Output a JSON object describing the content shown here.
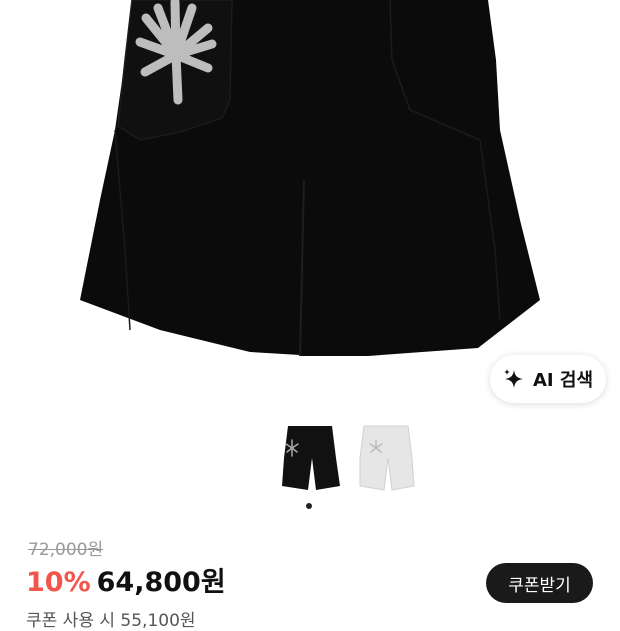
{
  "product": {
    "main_image": "black-shorts-photo",
    "ai_search_label": "AI 검색",
    "ai_search_icon": "sparkle-icon",
    "thumbnails": [
      {
        "name": "black-shorts-thumbnail",
        "color": "#111111"
      },
      {
        "name": "white-shorts-thumbnail",
        "color": "#e6e6e6"
      }
    ],
    "carousel_dot": "page-indicator-dot"
  },
  "pricing": {
    "original_price": "72,000원",
    "discount": "10%",
    "sale_price": "64,800원",
    "coupon_button": "쿠폰받기",
    "coupon_price_text": "쿠폰 사용 시 55,100원"
  },
  "colors": {
    "discount": "#f2554b",
    "button_dark": "#1a1a1a"
  }
}
